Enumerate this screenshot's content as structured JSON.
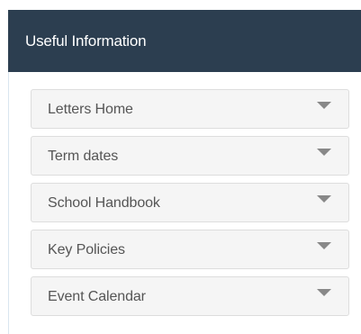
{
  "panel": {
    "title": "Useful Information",
    "items": [
      {
        "label": "Letters Home"
      },
      {
        "label": "Term dates"
      },
      {
        "label": "School Handbook"
      },
      {
        "label": "Key Policies"
      },
      {
        "label": "Event Calendar"
      }
    ]
  },
  "icons": {
    "expand": "caret-down-icon"
  },
  "colors": {
    "header_bg": "#2c3e50",
    "header_text": "#ffffff",
    "item_bg": "#f5f5f5",
    "item_border": "#dddddd",
    "item_text": "#555555",
    "caret": "#888888"
  }
}
